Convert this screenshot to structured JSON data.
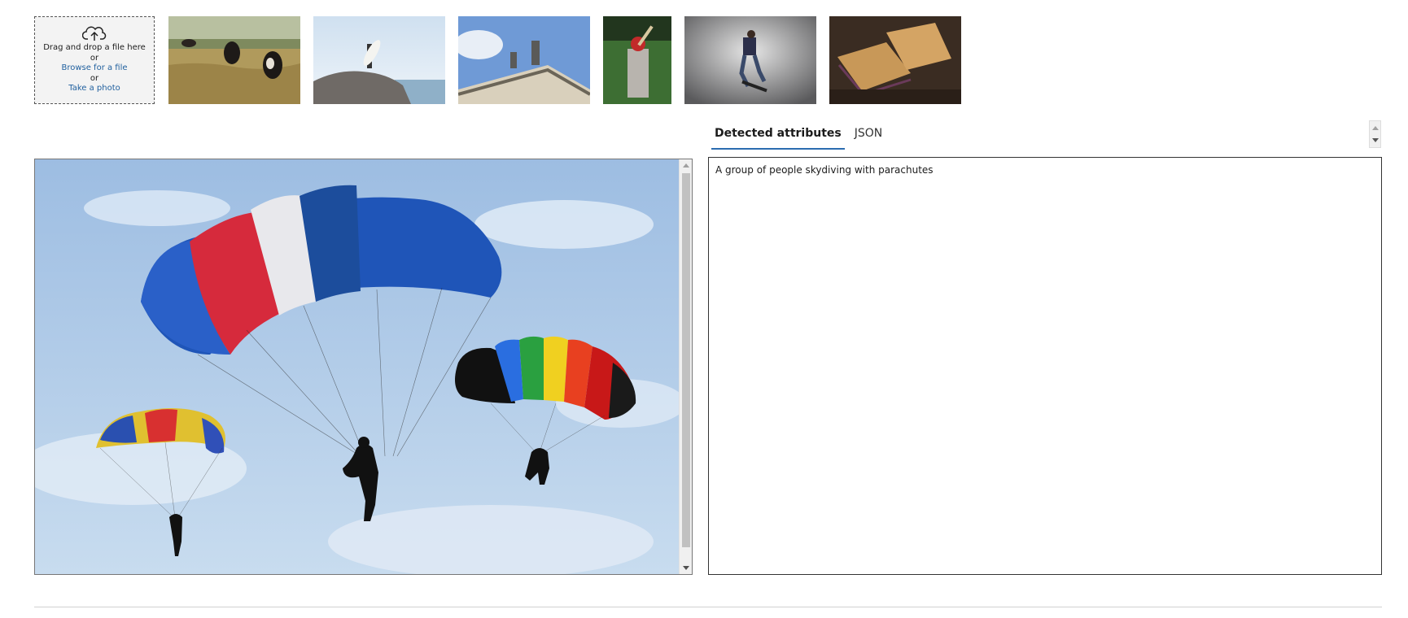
{
  "upload": {
    "drag_text": "Drag and drop a file here",
    "or_1": "or",
    "browse_label": "Browse for a file",
    "or_2": "or",
    "photo_label": "Take a photo"
  },
  "thumbnails": [
    {
      "name": "cows-grazing"
    },
    {
      "name": "surfer-on-rocks"
    },
    {
      "name": "building-statue"
    },
    {
      "name": "baseball-batter"
    },
    {
      "name": "skateboarder"
    },
    {
      "name": "grilled-sandwich"
    }
  ],
  "tabs": [
    {
      "label": "Detected attributes",
      "active": true
    },
    {
      "label": "JSON",
      "active": false
    }
  ],
  "result": {
    "caption": "A group of people skydiving with parachutes"
  },
  "colors": {
    "accent": "#2b6cb0",
    "link": "#1f5f9e",
    "sky": "#c9ddf0"
  }
}
